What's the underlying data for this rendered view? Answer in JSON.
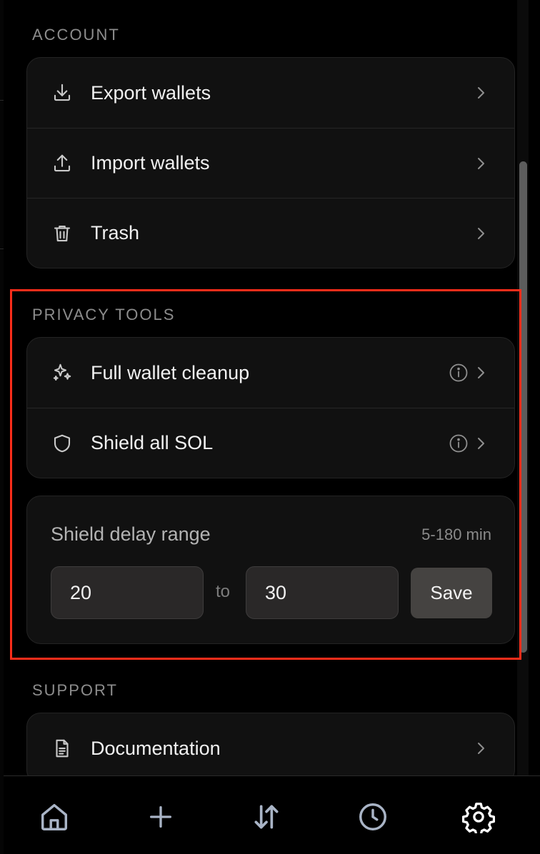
{
  "account": {
    "heading": "ACCOUNT",
    "items": [
      {
        "label": "Export wallets",
        "icon": "download-icon"
      },
      {
        "label": "Import wallets",
        "icon": "upload-icon"
      },
      {
        "label": "Trash",
        "icon": "trash-icon"
      }
    ]
  },
  "privacy": {
    "heading": "PRIVACY TOOLS",
    "items": [
      {
        "label": "Full wallet cleanup",
        "icon": "sparkles-icon"
      },
      {
        "label": "Shield all SOL",
        "icon": "shield-icon"
      }
    ],
    "delay": {
      "title": "Shield delay range",
      "range_hint": "5-180 min",
      "min_value": "20",
      "max_value": "30",
      "to_label": "to",
      "save_label": "Save"
    }
  },
  "support": {
    "heading": "SUPPORT",
    "items": [
      {
        "label": "Documentation",
        "icon": "document-icon"
      }
    ]
  },
  "nav": {
    "items": [
      "home-icon",
      "plus-icon",
      "swap-icon",
      "history-icon",
      "settings-icon"
    ],
    "active_color": "#ffffff",
    "inactive_color": "#a9b4c6"
  },
  "colors": {
    "highlight": "#ff2d1a"
  }
}
